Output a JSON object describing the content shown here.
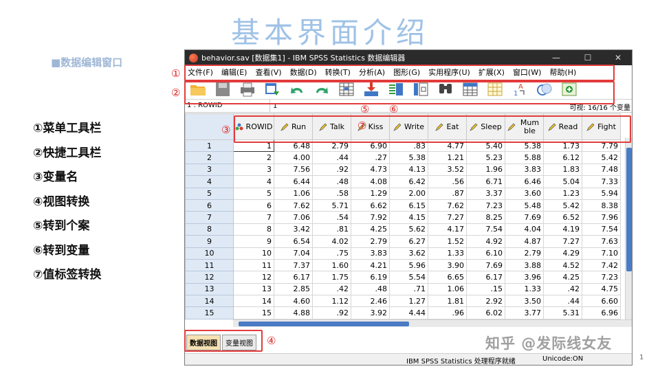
{
  "slide": {
    "title": "基本界面介绍",
    "subtitle": "■数据编辑窗口",
    "legend": [
      "①菜单工具栏",
      "②快捷工具栏",
      "③变量名",
      "④视图转换",
      "⑤转到个案",
      "⑥转到变量",
      "⑦值标签转换"
    ],
    "callouts": [
      "①",
      "②",
      "③",
      "④",
      "⑤",
      "⑥",
      "⑦"
    ],
    "watermark": "知乎 @发际线女友",
    "page_number": "1"
  },
  "window": {
    "title": "behavior.sav [数据集1] - IBM SPSS Statistics 数据编辑器",
    "minimize": "—",
    "maximize": "☐",
    "close": "✕"
  },
  "menu": [
    "文件(F)",
    "编辑(E)",
    "查看(V)",
    "数据(D)",
    "转换(T)",
    "分析(A)",
    "图形(G)",
    "实用程序(U)",
    "扩展(X)",
    "窗口(W)",
    "帮助(H)"
  ],
  "toolbar_icons": [
    "open-folder-icon",
    "save-icon",
    "print-icon",
    "recall-dialog-icon",
    "undo-icon",
    "redo-icon",
    "goto-case-icon",
    "goto-variable-icon",
    "variables-icon",
    "run-descriptives-icon",
    "find-icon",
    "insert-cases-icon",
    "insert-variable-icon",
    "value-labels-icon",
    "use-sets-icon",
    "show-all-icon"
  ],
  "cellbar": {
    "ref": "1 : ROWID",
    "value": "1",
    "visible": "可视: 16/16 个变量"
  },
  "grid": {
    "columns": [
      "ROWID",
      "Run",
      "Talk",
      "Kiss",
      "Write",
      "Eat",
      "Sleep",
      "Mumble",
      "Read",
      "Fight"
    ],
    "rows": [
      [
        "1",
        "1",
        "6.48",
        "2.79",
        "6.90",
        ".83",
        "4.77",
        "5.40",
        "5.38",
        "1.73",
        "7.79"
      ],
      [
        "2",
        "2",
        "4.00",
        ".44",
        ".27",
        "5.38",
        "1.21",
        "5.23",
        "5.88",
        "6.12",
        "5.42"
      ],
      [
        "3",
        "3",
        "7.56",
        ".92",
        "4.73",
        "4.13",
        "3.52",
        "1.96",
        "3.83",
        "1.83",
        "7.48"
      ],
      [
        "4",
        "4",
        "6.44",
        ".48",
        "4.08",
        "6.42",
        ".56",
        "6.71",
        "6.46",
        "5.04",
        "7.33"
      ],
      [
        "5",
        "5",
        "1.06",
        ".58",
        "1.29",
        "2.00",
        ".87",
        "3.37",
        "3.60",
        "1.23",
        "5.94"
      ],
      [
        "6",
        "6",
        "7.62",
        "5.71",
        "6.62",
        "6.15",
        "7.62",
        "7.23",
        "5.48",
        "5.42",
        "8.38"
      ],
      [
        "7",
        "7",
        "7.06",
        ".54",
        "7.92",
        "4.15",
        "7.27",
        "8.25",
        "7.69",
        "6.52",
        "7.96"
      ],
      [
        "8",
        "8",
        "3.42",
        ".81",
        "4.25",
        "5.62",
        "4.17",
        "7.54",
        "4.04",
        "4.19",
        "7.54"
      ],
      [
        "9",
        "9",
        "6.54",
        "4.02",
        "2.79",
        "6.27",
        "1.52",
        "4.92",
        "4.87",
        "7.27",
        "7.63"
      ],
      [
        "10",
        "10",
        "7.04",
        ".75",
        "3.83",
        "3.62",
        "1.33",
        "6.10",
        "2.79",
        "4.29",
        "7.10"
      ],
      [
        "11",
        "11",
        "7.37",
        "1.60",
        "4.21",
        "5.96",
        "3.90",
        "7.69",
        "3.88",
        "4.52",
        "7.42"
      ],
      [
        "12",
        "12",
        "6.17",
        "1.75",
        "6.19",
        "5.54",
        "6.65",
        "6.17",
        "3.96",
        "4.25",
        "7.23"
      ],
      [
        "13",
        "13",
        "2.85",
        ".42",
        ".48",
        ".71",
        "1.06",
        ".15",
        "1.33",
        ".42",
        "4.75"
      ],
      [
        "14",
        "14",
        "4.60",
        "1.12",
        "2.46",
        "1.27",
        "1.81",
        "2.92",
        "3.50",
        ".44",
        "6.60"
      ],
      [
        "15",
        "15",
        "4.88",
        ".92",
        "3.92",
        "4.44",
        ".96",
        "6.02",
        "3.77",
        "5.31",
        "6.96"
      ]
    ]
  },
  "tabs": {
    "data_view": "数据视图",
    "variable_view": "变量视图"
  },
  "status": {
    "processor": "IBM SPSS Statistics 处理程序就绪",
    "unicode": "Unicode:ON"
  },
  "colors": {
    "callout": "#e23b3b",
    "title": "#9fc2e6",
    "scroll_thumb": "#4a7bc4"
  }
}
